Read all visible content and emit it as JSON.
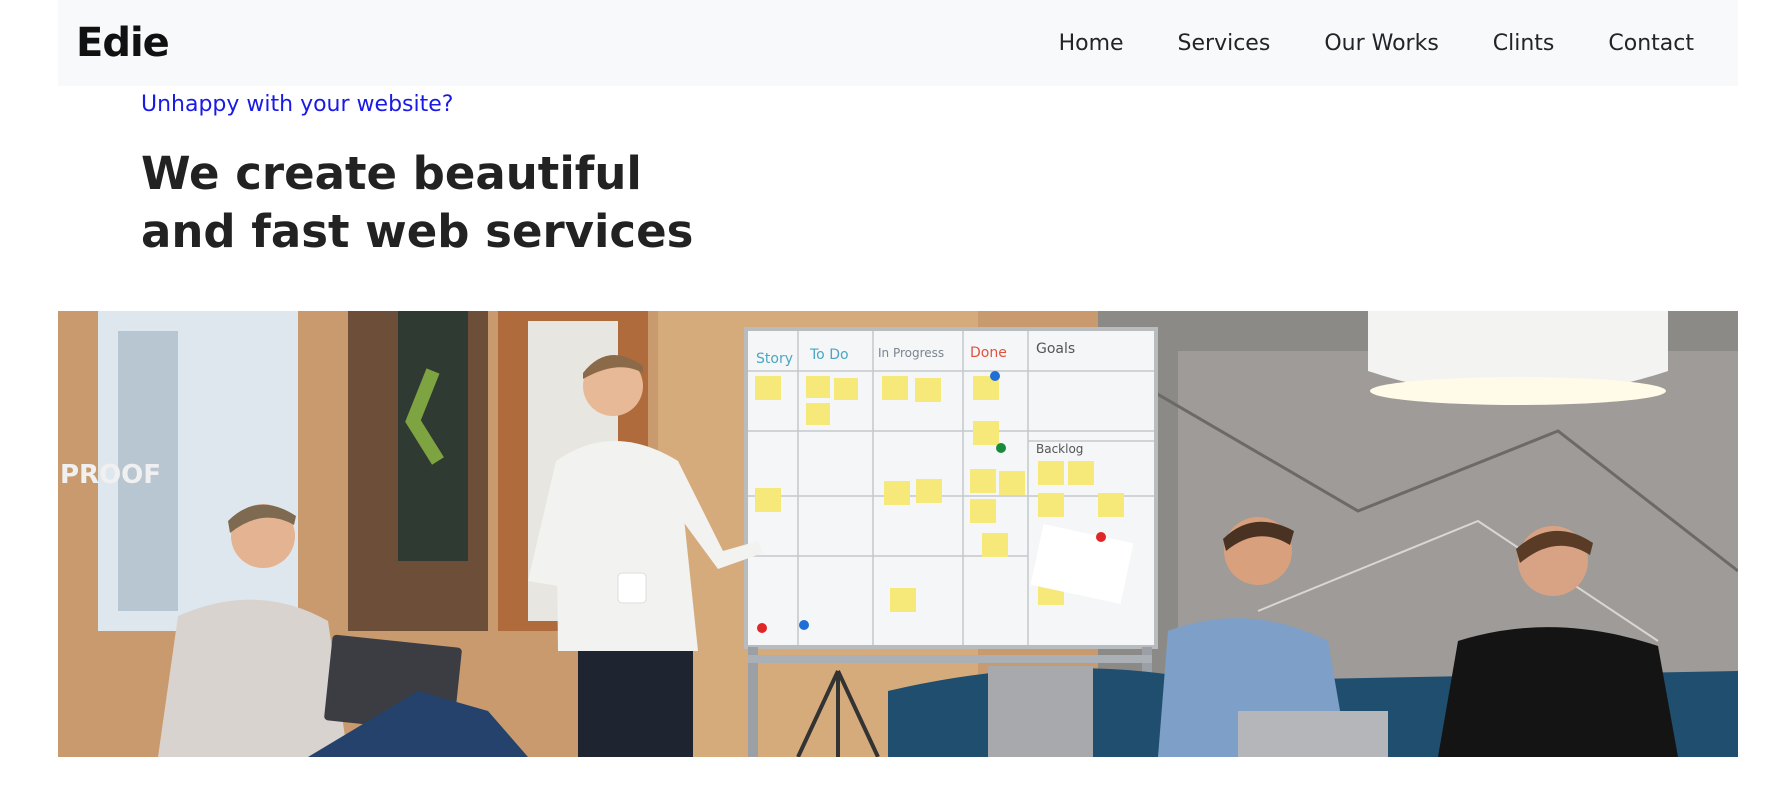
{
  "navbar": {
    "brand": "Edie",
    "links": [
      {
        "label": "Home"
      },
      {
        "label": "Services"
      },
      {
        "label": "Our Works"
      },
      {
        "label": "Clints"
      },
      {
        "label": "Contact"
      }
    ]
  },
  "hero": {
    "eyebrow": "Unhappy with your website?",
    "headline_line1": "We create beautiful",
    "headline_line2": "and fast web services"
  },
  "photo": {
    "whiteboard_columns": [
      "Story",
      "To Do",
      "In Progress",
      "Done",
      "Goals"
    ],
    "backlog_label": "Backlog",
    "wall_sign": "PROOF"
  },
  "colors": {
    "nav_bg": "#f8f9fa",
    "eyebrow": "#1a1ae6",
    "headline": "#222222"
  }
}
